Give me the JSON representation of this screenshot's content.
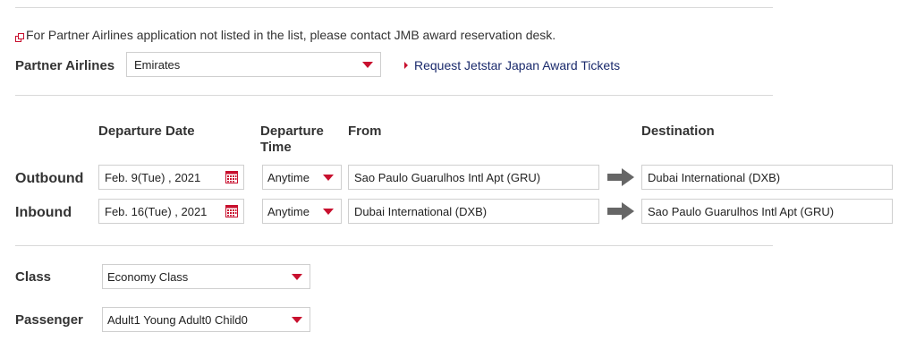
{
  "note": {
    "text": "For Partner Airlines application not listed in the list, please contact JMB award reservation desk.",
    "icon": "external-link-icon"
  },
  "partner": {
    "label": "Partner Airlines",
    "value": "Emirates"
  },
  "request_link": "Request Jetstar Japan Award Tickets",
  "columns": {
    "departure_date": "Departure Date",
    "departure_time_1": "Departure",
    "departure_time_2": "Time",
    "from": "From",
    "destination": "Destination"
  },
  "outbound": {
    "label": "Outbound",
    "date": "Feb. 9(Tue) , 2021",
    "time": "Anytime",
    "from": "Sao Paulo Guarulhos Intl Apt (GRU)",
    "to": "Dubai International (DXB)"
  },
  "inbound": {
    "label": "Inbound",
    "date": "Feb. 16(Tue) , 2021",
    "time": "Anytime",
    "from": "Dubai International (DXB)",
    "to": "Sao Paulo Guarulhos Intl Apt (GRU)"
  },
  "class": {
    "label": "Class",
    "value": "Economy Class"
  },
  "passenger": {
    "label": "Passenger",
    "value": "Adult1 Young Adult0 Child0"
  },
  "colors": {
    "accent": "#c8102e",
    "link": "#1a2a6c",
    "arrow": "#666666"
  }
}
